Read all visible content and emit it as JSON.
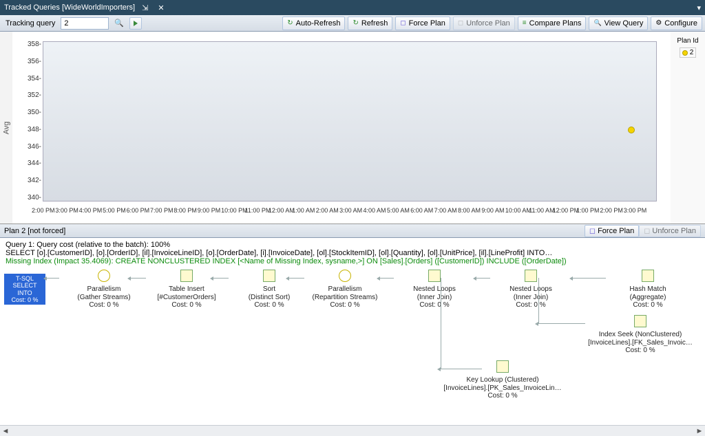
{
  "titlebar": {
    "title": "Tracked Queries [WideWorldImporters]"
  },
  "toolbar": {
    "tracking_label": "Tracking query",
    "tracking_value": "2",
    "auto_refresh": "Auto-Refresh",
    "refresh": "Refresh",
    "force_plan": "Force Plan",
    "unforce_plan": "Unforce Plan",
    "compare_plans": "Compare Plans",
    "view_query": "View Query",
    "configure": "Configure"
  },
  "chart": {
    "y_label": "Avg",
    "legend_title": "Plan Id",
    "legend_item": "2"
  },
  "chart_data": {
    "type": "scatter",
    "xlabel": "",
    "ylabel": "Avg",
    "ylim": [
      340,
      358
    ],
    "y_ticks": [
      358,
      356,
      354,
      352,
      350,
      348,
      346,
      344,
      342,
      340
    ],
    "x_ticks": [
      "2:00 PM",
      "3:00 PM",
      "4:00 PM",
      "5:00 PM",
      "6:00 PM",
      "7:00 PM",
      "8:00 PM",
      "9:00 PM",
      "10:00 PM",
      "11:00 PM",
      "12:00 AM",
      "1:00 AM",
      "2:00 AM",
      "3:00 AM",
      "4:00 AM",
      "5:00 AM",
      "6:00 AM",
      "7:00 AM",
      "8:00 AM",
      "9:00 AM",
      "10:00 AM",
      "11:00 AM",
      "12:00 PM",
      "1:00 PM",
      "2:00 PM",
      "3:00 PM"
    ],
    "series": [
      {
        "name": "2",
        "points": [
          {
            "x": "2:00 PM (next day)",
            "x_index": 24,
            "y": 348
          }
        ]
      }
    ]
  },
  "planbar": {
    "title": "Plan 2 [not forced]",
    "force_plan": "Force Plan",
    "unforce_plan": "Unforce Plan"
  },
  "query_text": {
    "line1": "Query 1: Query cost (relative to the batch): 100%",
    "line2": "SELECT [o].[CustomerID], [o].[OrderID], [il].[InvoiceLineID], [o].[OrderDate], [i].[InvoiceDate], [ol].[StockItemID], [ol].[Quantity], [ol].[UnitPrice], [il].[LineProfit] INTO…",
    "line3": "Missing Index (Impact 35.4069): CREATE NONCLUSTERED INDEX [<Name of Missing Index, sysname,>] ON [Sales].[Orders] ([CustomerID]) INCLUDE ([OrderDate])"
  },
  "plan_nodes": {
    "root_label": "SELECT INTO",
    "root_cost": "Cost: 0 %",
    "root_tsql": "T-SQL",
    "n1_t": "Parallelism",
    "n1_s": "(Gather Streams)",
    "n1_c": "Cost: 0 %",
    "n2_t": "Table Insert",
    "n2_s": "[#CustomerOrders]",
    "n2_c": "Cost: 0 %",
    "n3_t": "Sort",
    "n3_s": "(Distinct Sort)",
    "n3_c": "Cost: 0 %",
    "n4_t": "Parallelism",
    "n4_s": "(Repartition Streams)",
    "n4_c": "Cost: 0 %",
    "n5_t": "Nested Loops",
    "n5_s": "(Inner Join)",
    "n5_c": "Cost: 0 %",
    "n6_t": "Nested Loops",
    "n6_s": "(Inner Join)",
    "n6_c": "Cost: 0 %",
    "n7_t": "Hash Match",
    "n7_s": "(Aggregate)",
    "n7_c": "Cost: 0 %",
    "n8_t": "Index Seek (NonClustered)",
    "n8_s": "[InvoiceLines].[FK_Sales_Invoic…",
    "n8_c": "Cost: 0 %",
    "n9_t": "Key Lookup (Clustered)",
    "n9_s": "[InvoiceLines].[PK_Sales_InvoiceLin…",
    "n9_c": "Cost: 0 %"
  }
}
